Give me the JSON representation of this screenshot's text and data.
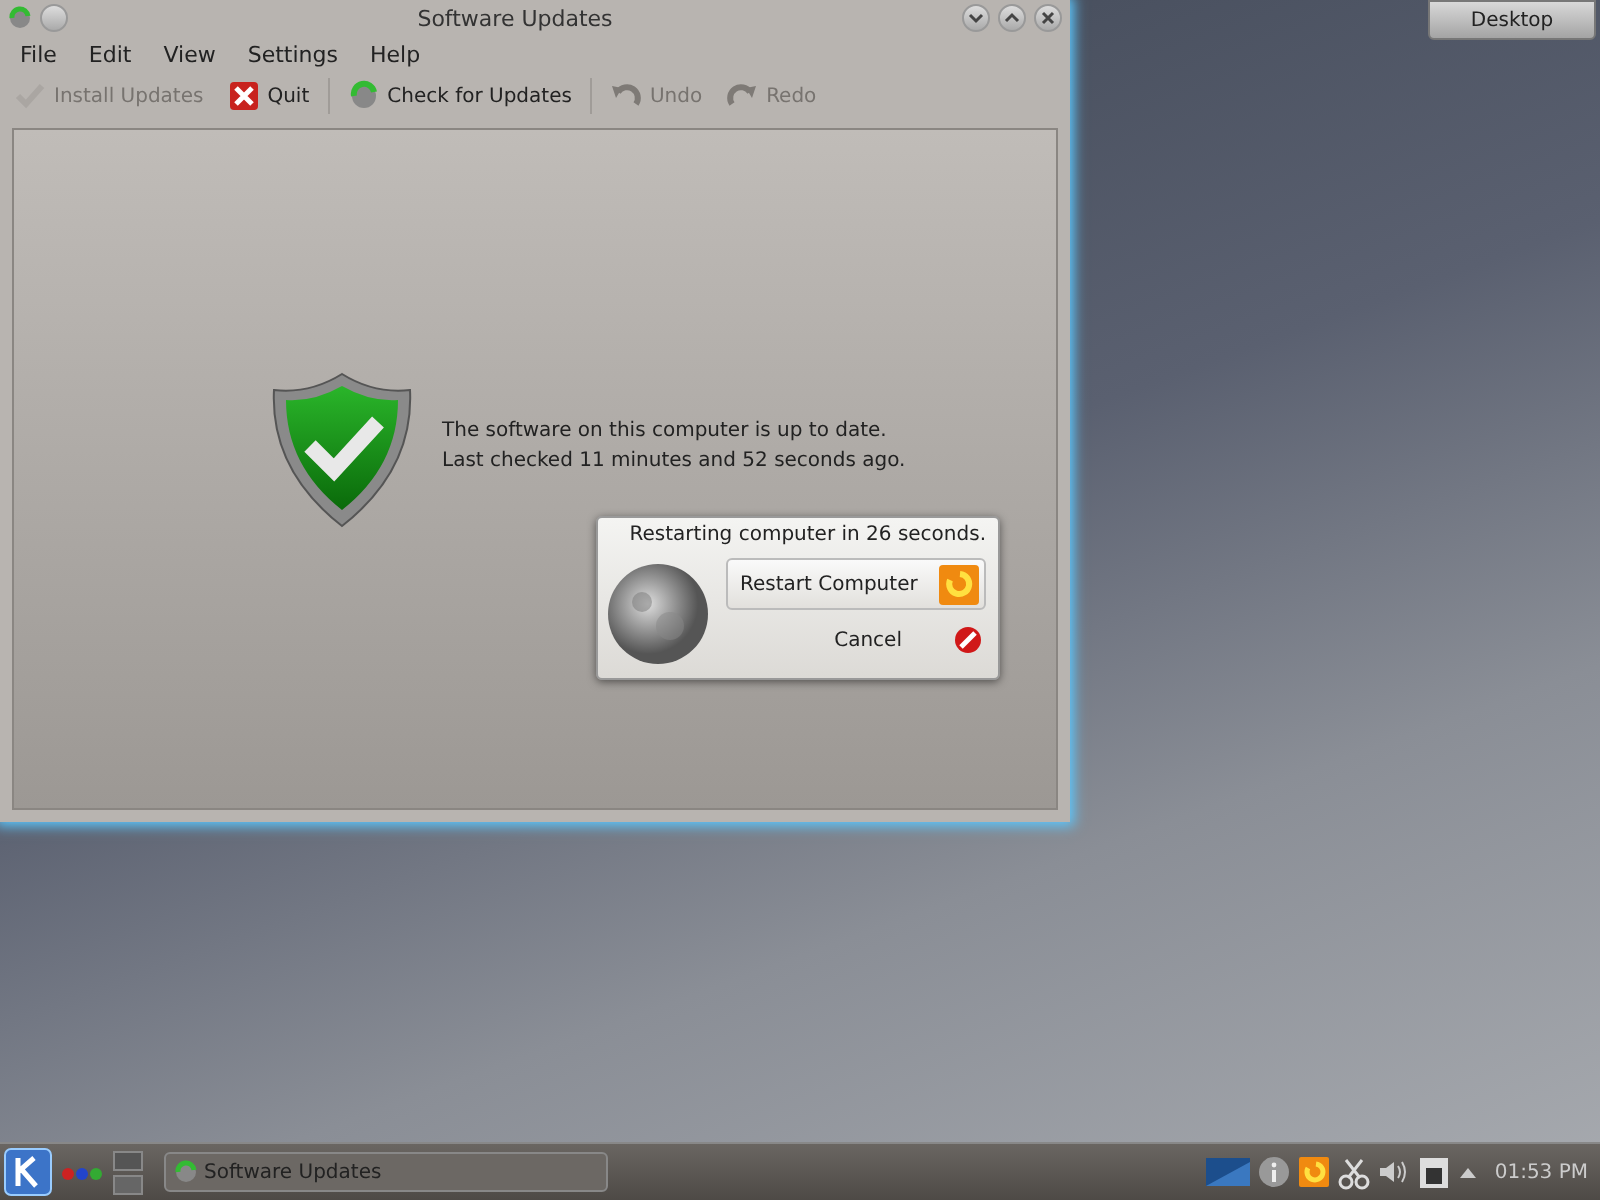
{
  "window": {
    "title": "Software Updates"
  },
  "menu": [
    "File",
    "Edit",
    "View",
    "Settings",
    "Help"
  ],
  "toolbar": [
    {
      "label": "Install Updates",
      "kind": "check",
      "disabled": true
    },
    {
      "label": "Quit",
      "kind": "quit",
      "disabled": false
    },
    {
      "label": "Check for Updates",
      "kind": "refresh",
      "disabled": false
    },
    {
      "label": "Undo",
      "kind": "undo",
      "disabled": true
    },
    {
      "label": "Redo",
      "kind": "redo",
      "disabled": true
    }
  ],
  "status": {
    "lines": [
      "The software on this computer is up to date.",
      "Last checked 11 minutes and 52 seconds ago."
    ]
  },
  "dialog": {
    "message": "Restarting computer in 26 seconds.",
    "buttons": [
      {
        "label": "Restart Computer",
        "kind": "restart"
      },
      {
        "label": "Cancel",
        "kind": "cancel"
      }
    ]
  },
  "desktop_button": "Desktop",
  "taskbar": {
    "task": "Software Updates",
    "clock": "01:53 PM"
  }
}
